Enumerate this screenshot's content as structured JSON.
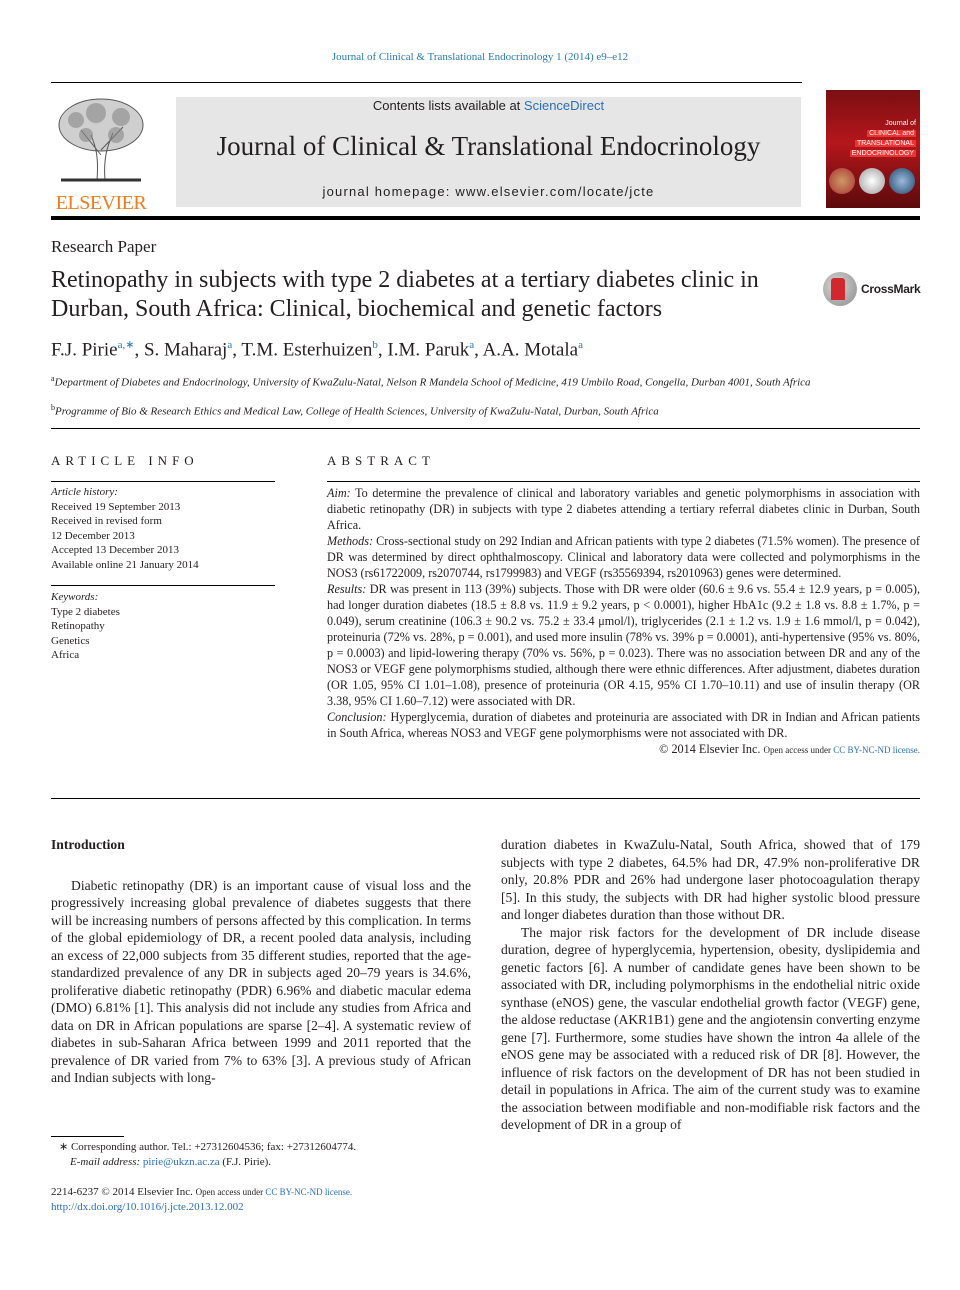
{
  "header": {
    "running_head": "Journal of Clinical & Translational Endocrinology 1 (2014) e9–e12",
    "publisher_logo_text": "ELSEVIER",
    "contents_prefix": "Contents lists available at ",
    "contents_link": "ScienceDirect",
    "journal_name": "Journal of Clinical & Translational Endocrinology",
    "homepage": "journal homepage: www.elsevier.com/locate/jcte",
    "cover_lines": [
      "Journal of",
      "CLINICAL and",
      "TRANSLATIONAL",
      "ENDOCRINOLOGY"
    ]
  },
  "article": {
    "type": "Research Paper",
    "title": "Retinopathy in subjects with type 2 diabetes at a tertiary diabetes clinic in Durban, South Africa: Clinical, biochemical and genetic factors",
    "crossmark_label": "CrossMark",
    "authors": [
      {
        "name": "F.J. Pirie",
        "sup": "a,∗",
        "sep": ", "
      },
      {
        "name": "S. Maharaj",
        "sup": "a",
        "sep": ", "
      },
      {
        "name": "T.M. Esterhuizen",
        "sup": "b",
        "sep": ", "
      },
      {
        "name": "I.M. Paruk",
        "sup": "a",
        "sep": ", "
      },
      {
        "name": "A.A. Motala",
        "sup": "a",
        "sep": ""
      }
    ],
    "affiliations": [
      {
        "mark": "a",
        "text": "Department of Diabetes and Endocrinology, University of KwaZulu-Natal, Nelson R Mandela School of Medicine, 419 Umbilo Road, Congella, Durban 4001, South Africa"
      },
      {
        "mark": "b",
        "text": "Programme of Bio & Research Ethics and Medical Law, College of Health Sciences, University of KwaZulu-Natal, Durban, South Africa"
      }
    ]
  },
  "article_info": {
    "heading": "ARTICLE INFO",
    "history_label": "Article history:",
    "history": [
      "Received 19 September 2013",
      "Received in revised form",
      "12 December 2013",
      "Accepted 13 December 2013",
      "Available online 21 January 2014"
    ],
    "keywords_label": "Keywords:",
    "keywords": [
      "Type 2 diabetes",
      "Retinopathy",
      "Genetics",
      "Africa"
    ]
  },
  "abstract": {
    "heading": "ABSTRACT",
    "aim_label": "Aim:",
    "aim": "To determine the prevalence of clinical and laboratory variables and genetic polymorphisms in association with diabetic retinopathy (DR) in subjects with type 2 diabetes attending a tertiary referral diabetes clinic in Durban, South Africa.",
    "methods_label": "Methods:",
    "methods": "Cross-sectional study on 292 Indian and African patients with type 2 diabetes (71.5% women). The presence of DR was determined by direct ophthalmoscopy. Clinical and laboratory data were collected and polymorphisms in the NOS3 (rs61722009, rs2070744, rs1799983) and VEGF (rs35569394, rs2010963) genes were determined.",
    "results_label": "Results:",
    "results": "DR was present in 113 (39%) subjects. Those with DR were older (60.6 ± 9.6 vs. 55.4 ± 12.9 years, p = 0.005), had longer duration diabetes (18.5 ± 8.8 vs. 11.9 ± 9.2 years, p < 0.0001), higher HbA1c (9.2 ± 1.8 vs. 8.8 ± 1.7%, p = 0.049), serum creatinine (106.3 ± 90.2 vs. 75.2 ± 33.4 μmol/l), triglycerides (2.1 ± 1.2 vs. 1.9 ± 1.6 mmol/l, p = 0.042), proteinuria (72% vs. 28%, p = 0.001), and used more insulin (78% vs. 39% p = 0.0001), anti-hypertensive (95% vs. 80%, p = 0.0003) and lipid-lowering therapy (70% vs. 56%, p = 0.023). There was no association between DR and any of the NOS3 or VEGF gene polymorphisms studied, although there were ethnic differences. After adjustment, diabetes duration (OR 1.05, 95% CI 1.01–1.08), presence of proteinuria (OR 4.15, 95% CI 1.70–10.11) and use of insulin therapy (OR 3.38, 95% CI 1.60–7.12) were associated with DR.",
    "conclusion_label": "Conclusion:",
    "conclusion": "Hyperglycemia, duration of diabetes and proteinuria are associated with DR in Indian and African patients in South Africa, whereas NOS3 and VEGF gene polymorphisms were not associated with DR.",
    "copyright": "© 2014 Elsevier Inc.",
    "open_access": "Open access under ",
    "license_link": "CC BY-NC-ND license."
  },
  "body": {
    "intro_heading": "Introduction",
    "left_paragraph": "Diabetic retinopathy (DR) is an important cause of visual loss and the progressively increasing global prevalence of diabetes suggests that there will be increasing numbers of persons affected by this complication. In terms of the global epidemiology of DR, a recent pooled data analysis, including an excess of 22,000 subjects from 35 different studies, reported that the age-standardized prevalence of any DR in subjects aged 20–79 years is 34.6%, proliferative diabetic retinopathy (PDR) 6.96% and diabetic macular edema (DMO) 6.81% [1]. This analysis did not include any studies from Africa and data on DR in African populations are sparse [2–4]. A systematic review of diabetes in sub-Saharan Africa between 1999 and 2011 reported that the prevalence of DR varied from 7% to 63% [3]. A previous study of African and Indian subjects with long-",
    "right_paragraph_1": "duration diabetes in KwaZulu-Natal, South Africa, showed that of 179 subjects with type 2 diabetes, 64.5% had DR, 47.9% non-proliferative DR only, 20.8% PDR and 26% had undergone laser photocoagulation therapy [5]. In this study, the subjects with DR had higher systolic blood pressure and longer diabetes duration than those without DR.",
    "right_paragraph_2": "The major risk factors for the development of DR include disease duration, degree of hyperglycemia, hypertension, obesity, dyslipidemia and genetic factors [6]. A number of candidate genes have been shown to be associated with DR, including polymorphisms in the endothelial nitric oxide synthase (eNOS) gene, the vascular endothelial growth factor (VEGF) gene, the aldose reductase (AKR1B1) gene and the angiotensin converting enzyme gene [7]. Furthermore, some studies have shown the intron 4a allele of the eNOS gene may be associated with a reduced risk of DR [8]. However, the influence of risk factors on the development of DR has not been studied in detail in populations in Africa. The aim of the current study was to examine the association between modifiable and non-modifiable risk factors and the development of DR in a group of"
  },
  "footnotes": {
    "corresponding": "∗ Corresponding author. Tel.: +27312604536; fax: +27312604774.",
    "email_label": "E-mail address: ",
    "email": "pirie@ukzn.ac.za",
    "email_suffix": " (F.J. Pirie).",
    "issn": "2214-6237 © 2014 Elsevier Inc. ",
    "open_access": "Open access under ",
    "license_link": "CC BY-NC-ND license.",
    "doi": "http://dx.doi.org/10.1016/j.jcte.2013.12.002"
  }
}
